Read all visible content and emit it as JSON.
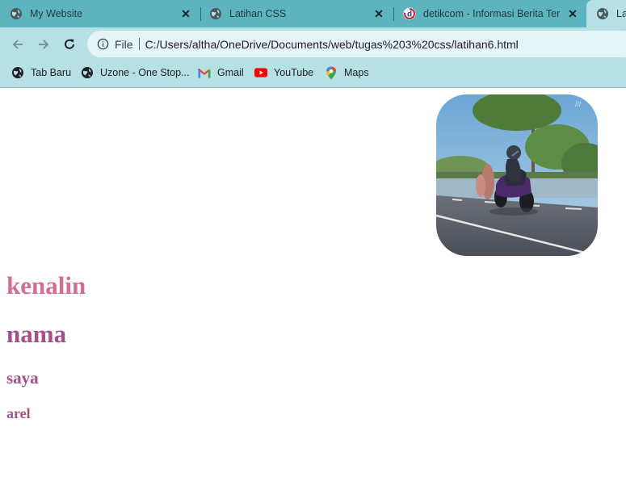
{
  "tabs": [
    {
      "title": "My Website",
      "icon": "globe-icon"
    },
    {
      "title": "Latihan CSS",
      "icon": "globe-icon"
    },
    {
      "title": "detikcom - Informasi Berita Terkini",
      "icon": "detik-icon"
    },
    {
      "title": "Lat",
      "icon": "globe-icon",
      "active": true
    }
  ],
  "toolbar": {
    "scheme_label": "File",
    "url": "C:/Users/altha/OneDrive/Documents/web/tugas%203%20css/latihan6.html"
  },
  "bookmarks": [
    {
      "label": "Tab Baru",
      "icon": "globe-icon"
    },
    {
      "label": "Uzone - One Stop...",
      "icon": "globe-icon"
    },
    {
      "label": "Gmail",
      "icon": "gmail-icon"
    },
    {
      "label": "YouTube",
      "icon": "youtube-icon"
    },
    {
      "label": "Maps",
      "icon": "maps-icon"
    }
  ],
  "content": {
    "heading1": "kenalin",
    "heading2": "nama",
    "heading3": "saya",
    "heading4": "arel",
    "image_subject": "motorcycle-racer-photo"
  },
  "colors": {
    "tabstrip": "#5db3be",
    "toolbar": "#b6e0e4",
    "heading1": "#d46e8f",
    "headings": "#a64f8a"
  }
}
